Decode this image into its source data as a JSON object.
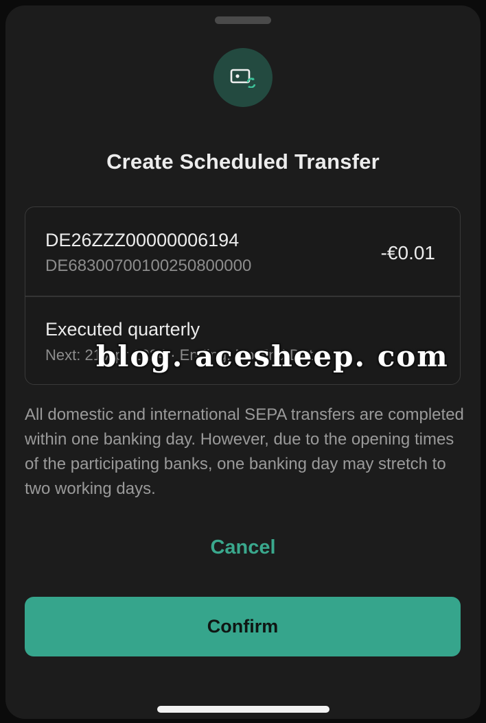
{
  "sheet": {
    "title": "Create Scheduled Transfer",
    "hero_icon": "money-repeat-icon"
  },
  "transfer": {
    "payee": "DE26ZZZ00000006194",
    "iban": "DE68300700100250800000",
    "amount": "-€0.01",
    "frequency": "Executed quarterly",
    "next_line": "Next: 21 Apr 2024 · Ending: No End Date"
  },
  "info_text": "All domestic and international SEPA transfers are completed within one banking day. However, due to the opening times of the participating banks, one banking day may stretch to two working days.",
  "actions": {
    "cancel_label": "Cancel",
    "confirm_label": "Confirm"
  },
  "watermark": "blog. acesheep. com",
  "colors": {
    "background": "#1c1c1c",
    "accent": "#36a58c",
    "accent_text": "#3aa88d",
    "icon_bg": "#234a40"
  }
}
